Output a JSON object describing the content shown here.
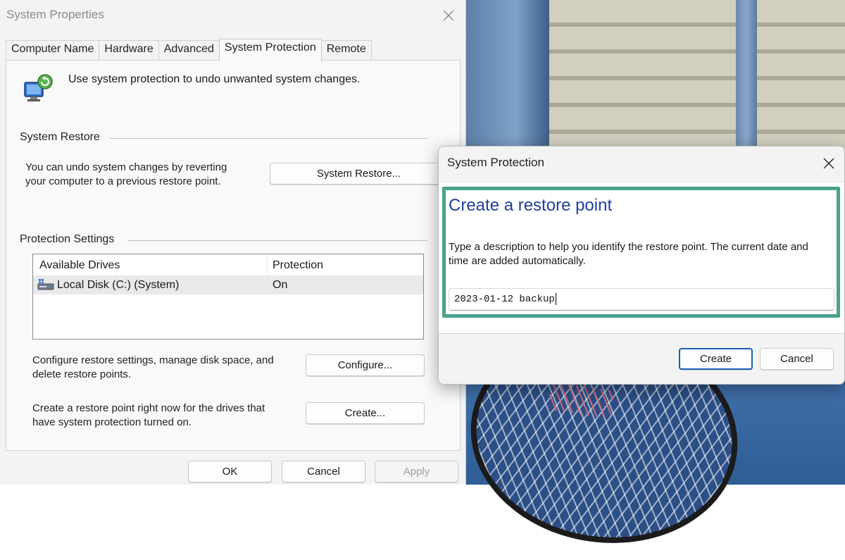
{
  "system_properties": {
    "title": "System Properties",
    "tabs": [
      {
        "label": "Computer Name"
      },
      {
        "label": "Hardware"
      },
      {
        "label": "Advanced"
      },
      {
        "label": "System Protection",
        "active": true
      },
      {
        "label": "Remote"
      }
    ],
    "intro_text": "Use system protection to undo unwanted system changes.",
    "system_restore": {
      "group_title": "System Restore",
      "description_line1": "You can undo system changes by reverting",
      "description_line2": "your computer to a previous restore point.",
      "button_label": "System Restore..."
    },
    "protection_settings": {
      "group_title": "Protection Settings",
      "columns": [
        "Available Drives",
        "Protection"
      ],
      "drives": [
        {
          "name": "Local Disk (C:) (System)",
          "protection": "On",
          "icon": "drive-icon"
        }
      ],
      "configure_text_line1": "Configure restore settings, manage disk space, and",
      "configure_text_line2": "delete restore points.",
      "configure_button": "Configure...",
      "create_text_line1": "Create a restore point right now for the drives that",
      "create_text_line2": "have system protection turned on.",
      "create_button": "Create..."
    },
    "footer": {
      "ok": "OK",
      "cancel": "Cancel",
      "apply": "Apply",
      "apply_enabled": false
    }
  },
  "system_protection_dialog": {
    "title": "System Protection",
    "heading": "Create a restore point",
    "description_line1": "Type a description to help you identify the restore point. The current date and",
    "description_line2": "time are added automatically.",
    "input_value": "2023-01-12 backup",
    "create_button": "Create",
    "cancel_button": "Cancel",
    "highlight_color": "#4aa38d",
    "heading_color": "#1f3f9e"
  }
}
